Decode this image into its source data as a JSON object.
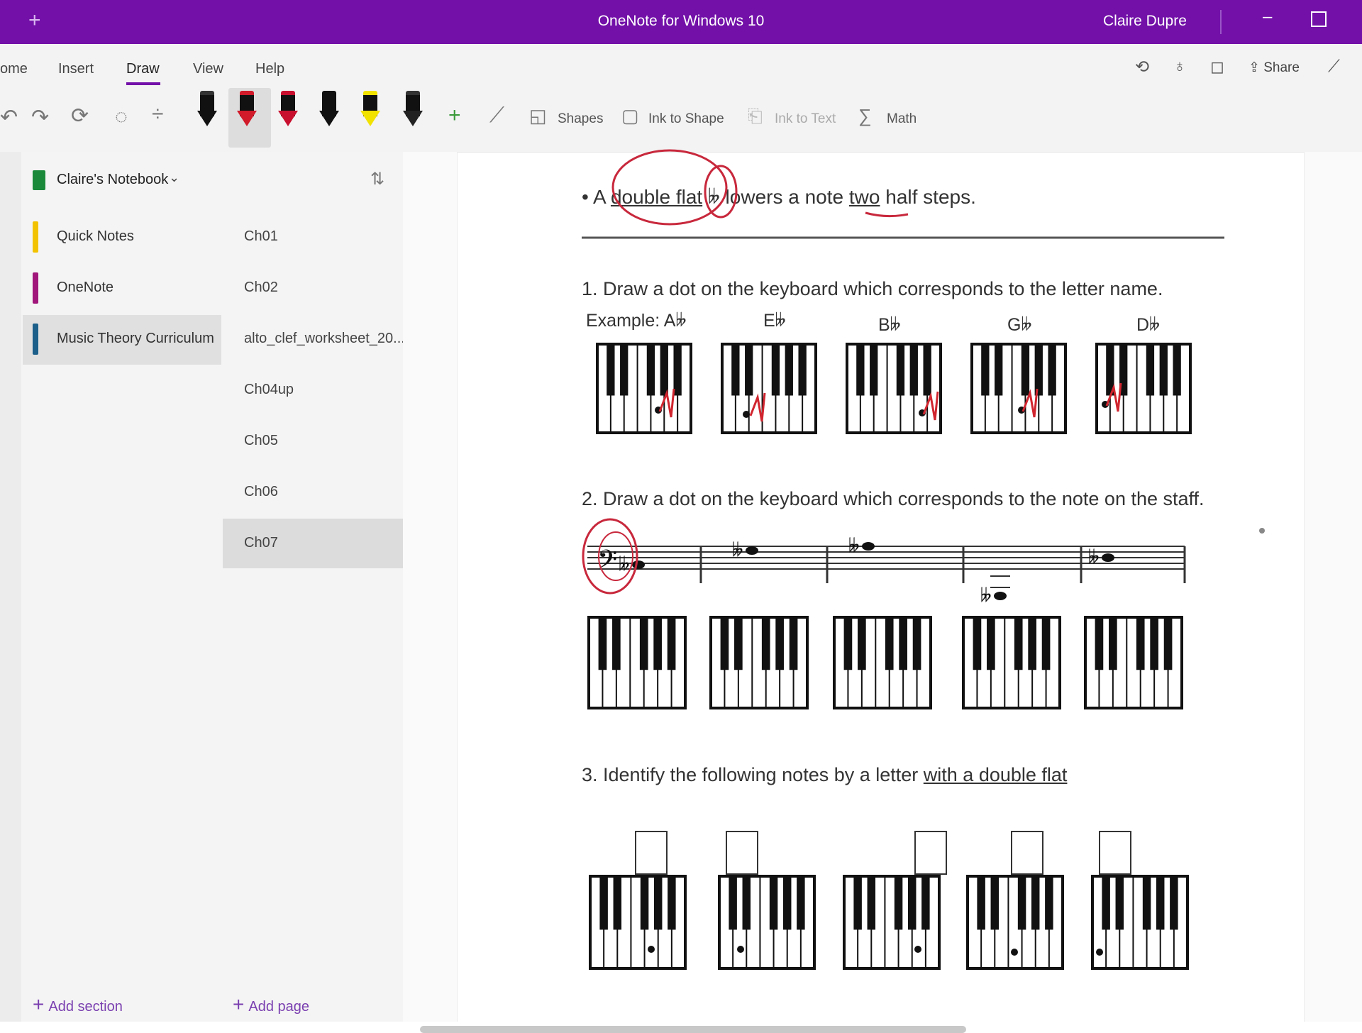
{
  "titlebar": {
    "back_icon": "+",
    "title": "OneNote for Windows 10",
    "user": "Claire Dupre",
    "minimize": "–"
  },
  "menu": [
    "ome",
    "Insert",
    "Draw",
    "View",
    "Help"
  ],
  "top_right": {
    "share_label": "Share"
  },
  "toolbar": {
    "shapes_label": "Shapes",
    "ink_to_shape_label": "Ink to Shape",
    "ink_to_text_label": "Ink to Text",
    "math_label": "Math",
    "pens": [
      {
        "color": "#111111",
        "band": "#333333"
      },
      {
        "color": "#d11a2a",
        "band": "#d11a2a",
        "selected": true
      },
      {
        "color": "#c8102e",
        "band": "#c8102e"
      },
      {
        "color": "#111111",
        "band": "#111111"
      },
      {
        "color": "#f2e200",
        "band": "#f2e200"
      },
      {
        "color": "#222222",
        "band": "#333333"
      }
    ]
  },
  "notebook": {
    "title": "Claire's Notebook"
  },
  "sections": [
    {
      "label": "Quick Notes",
      "color": "#f2c200"
    },
    {
      "label": "OneNote",
      "color": "#a0167a"
    },
    {
      "label": "Music Theory Curriculum",
      "color": "#1b5f8a",
      "selected": true
    }
  ],
  "pages": [
    "Ch01",
    "Ch02",
    "alto_clef_worksheet_20...",
    "Ch04up",
    "Ch05",
    "Ch06",
    "Ch07"
  ],
  "add_section": "Add section",
  "add_page": "Add page",
  "content": {
    "rule_prefix": "• A ",
    "rule_term": "double flat",
    "rule_symbol": "𝄫",
    "rule_mid": " lowers a note ",
    "rule_two": "two",
    "rule_end": " half steps.",
    "q1": "1. Draw a dot on the keyboard which corresponds to the letter name.",
    "q1_labels": [
      "Example: A𝄫",
      "E𝄫",
      "B𝄫",
      "G𝄫",
      "D𝄫"
    ],
    "q2": "2. Draw a dot on the keyboard which corresponds to the note on the staff.",
    "q3_prefix": "3. Identify the following notes by a letter ",
    "q3_emph": "with a double flat"
  }
}
